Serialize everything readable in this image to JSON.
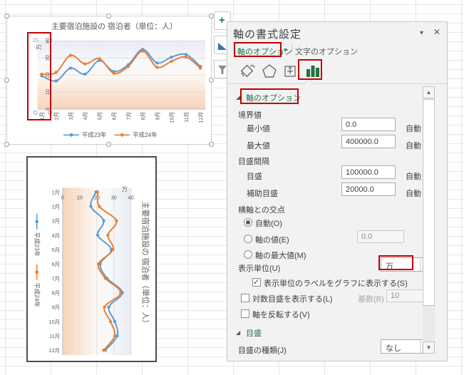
{
  "chart_data": {
    "type": "line",
    "title": "主要宿泊施設の 宿泊者（単位：人）",
    "unit_label": "万",
    "categories": [
      "1月",
      "2月",
      "3月",
      "4月",
      "5月",
      "6月",
      "7月",
      "8月",
      "9月",
      "10月",
      "11月",
      "12月"
    ],
    "series": [
      {
        "name": "平成23年",
        "color": "#5B9BD5",
        "values": [
          19.5,
          16.5,
          24,
          20.5,
          28.5,
          22,
          26,
          35,
          27,
          30.5,
          32,
          25
        ]
      },
      {
        "name": "平成24年",
        "color": "#ED7D31",
        "values": [
          20.5,
          21.5,
          31.5,
          26.5,
          29.5,
          21,
          25,
          34,
          24.5,
          28,
          30.5,
          24
        ]
      }
    ],
    "ylim": [
      0,
      40
    ],
    "yticks": [
      0,
      10,
      20,
      30,
      40
    ],
    "xlabel": "",
    "ylabel": "",
    "grid": true,
    "legend_position": "bottom",
    "gridline_color": "#d9d9d9",
    "plot_bg_top": "#e7ebf3",
    "plot_bg_bottom": "#f6d3bc"
  },
  "annotations": {
    "color": "#c00000"
  },
  "panel": {
    "title": "軸の書式設定",
    "collapse_icon": "▾",
    "close_icon": "✕",
    "tab_axis": "軸のオプション",
    "tab_caret": "▾",
    "tab_divider": "|",
    "tab_text": "文字のオプション",
    "section_axis": "軸のオプション",
    "section_marker": "◢",
    "bounds": {
      "label": "境界値",
      "min": {
        "label": "最小値",
        "value": "0.0",
        "auto": "自動"
      },
      "max": {
        "label": "最大値",
        "value": "400000.0",
        "auto": "自動"
      }
    },
    "units": {
      "label": "目盛間隔",
      "major": {
        "label": "目盛",
        "value": "100000.0",
        "auto": "自動"
      },
      "minor": {
        "label": "補助目盛",
        "value": "20000.0",
        "auto": "自動"
      }
    },
    "crosses": {
      "label": "横軸との交点",
      "auto": "自動(O)",
      "value_opt": "軸の値(E)",
      "value": "0.0",
      "max_opt": "軸の最大値(M)"
    },
    "display_units": {
      "label": "表示単位(U)",
      "value": "万",
      "arrow": "▾"
    },
    "show_unit_label": "表示単位のラベルをグラフに表示する(S)",
    "log": {
      "label": "対数目盛を表示する(L)",
      "base_label": "基数(B)",
      "base_value": "10"
    },
    "reverse_label": "軸を反転する(V)",
    "tick_section": "目盛",
    "tick_type": {
      "label": "目盛の種類(J)",
      "value": "なし",
      "arrow": "▾"
    },
    "scroll_up": "▲",
    "scroll_down": "▼"
  }
}
